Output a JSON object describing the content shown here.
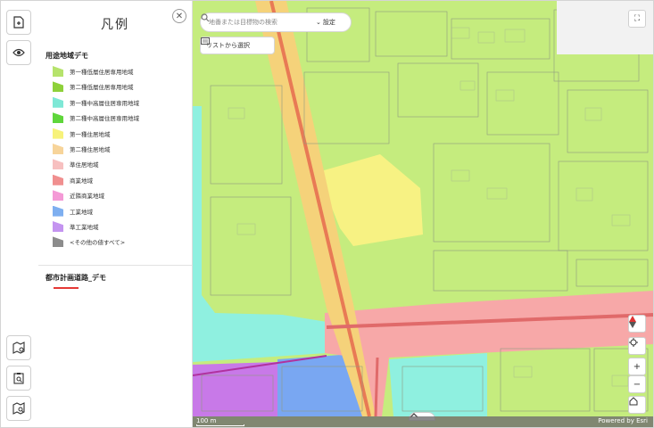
{
  "legend": {
    "title": "凡例",
    "section1_title": "用途地域デモ",
    "items": [
      {
        "label": "第一種低層住居専用地域",
        "color": "#b6e36c"
      },
      {
        "label": "第二種低層住居専用地域",
        "color": "#8ed13a"
      },
      {
        "label": "第一種中高層住居専用地域",
        "color": "#7ee8d6"
      },
      {
        "label": "第二種中高層住居専用地域",
        "color": "#5fd63b"
      },
      {
        "label": "第一種住居地域",
        "color": "#f7f27a"
      },
      {
        "label": "第二種住居地域",
        "color": "#f7d49a"
      },
      {
        "label": "準住居地域",
        "color": "#f7c0c0"
      },
      {
        "label": "商業地域",
        "color": "#f08f8f"
      },
      {
        "label": "近隣商業地域",
        "color": "#f49ad6"
      },
      {
        "label": "工業地域",
        "color": "#7eaff0"
      },
      {
        "label": "準工業地域",
        "color": "#c494f0"
      },
      {
        "label": "<その他の値すべて>",
        "color": "#8c8c8c"
      }
    ],
    "section2_title": "都市計画道路_デモ",
    "road_color": "#e53935"
  },
  "search": {
    "placeholder": "地番または目標物の検索",
    "settings_label": "設定"
  },
  "list_button_label": "リストから選択",
  "scale_label": "100 m",
  "attribution": "Powered by Esri",
  "icons": {
    "toolbar": [
      "add-document-icon",
      "eye-icon",
      "map-pin-icon",
      "clipboard-search-icon",
      "map-search-icon"
    ],
    "map_controls": [
      "compass-icon",
      "locate-icon",
      "zoom-in-icon",
      "zoom-out-icon",
      "home-icon",
      "fullscreen-icon"
    ]
  }
}
